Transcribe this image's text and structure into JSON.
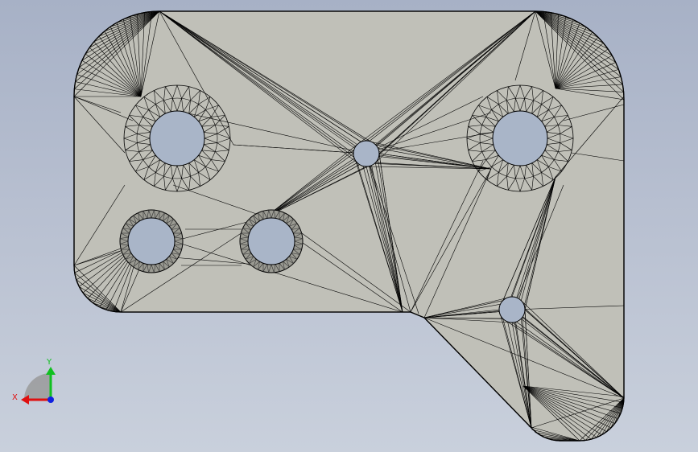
{
  "viewport": {
    "background_top": "#a7b1c6",
    "background_bottom": "#c9d0dc"
  },
  "part": {
    "fill_color": "#c0c0b8",
    "edge_color": "#000000",
    "hole_fill": "#a9b5c8",
    "ring_fill": "#9a9a92",
    "display_mode": "mesh-wireframe",
    "hole_count": 6
  },
  "triad": {
    "x_label": "X",
    "y_label": "Y",
    "x_color": "#e01010",
    "y_color": "#10c020",
    "z_color": "#1020e0",
    "icon": "coordinate-triad-icon"
  }
}
